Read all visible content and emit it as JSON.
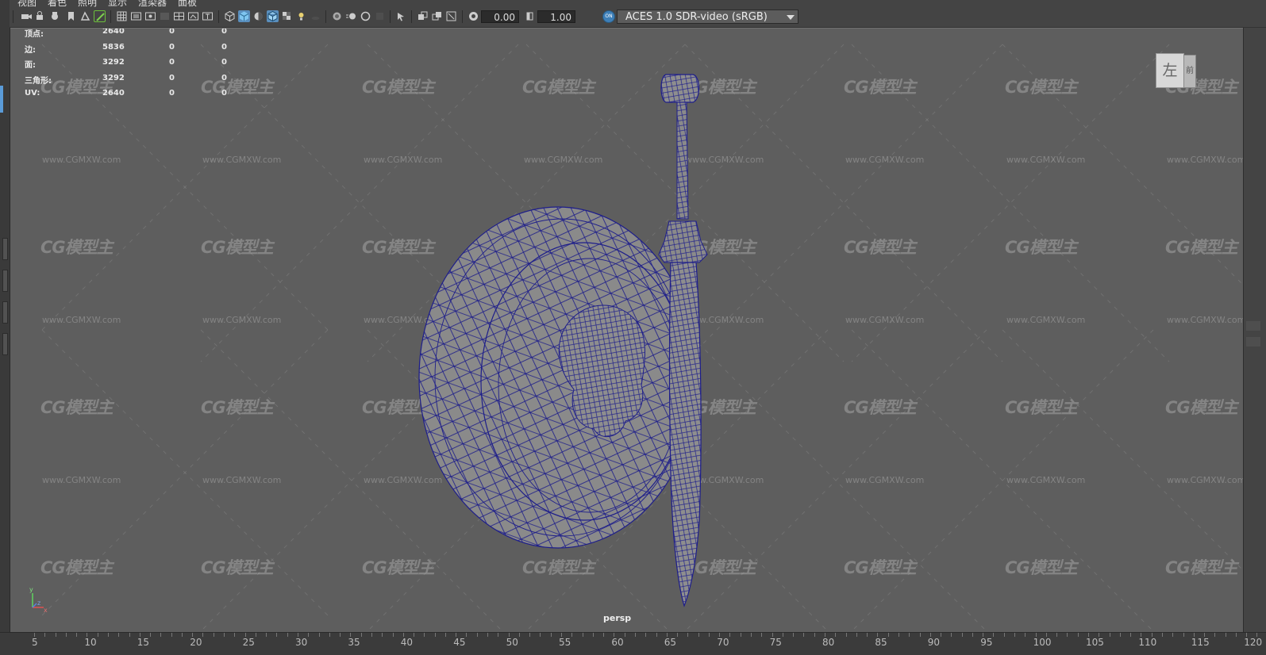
{
  "menu": [
    "视图",
    "着色",
    "照明",
    "显示",
    "渲染器",
    "面板"
  ],
  "toolbar": {
    "exposure_value": "0.00",
    "gamma_value": "1.00",
    "color_space": "ACES 1.0 SDR-video (sRGB)",
    "icons": [
      "camera-select-icon",
      "camera-attributes-icon",
      "bookmark-icon",
      "image-plane-icon",
      "film-gate-icon",
      "grid-icon",
      "wireframe-icon",
      "shaded-icon",
      "textured-icon",
      "lights-icon",
      "shadows-icon",
      "isolate-icon",
      "xray-icon",
      "exposure-icon",
      "gamma-icon",
      "color-management-icon"
    ]
  },
  "hud": {
    "rows": [
      {
        "label": "顶点:",
        "values": [
          "2640",
          "0",
          "0"
        ]
      },
      {
        "label": "边:",
        "values": [
          "5836",
          "0",
          "0"
        ]
      },
      {
        "label": "面:",
        "values": [
          "3292",
          "0",
          "0"
        ]
      },
      {
        "label": "三角形:",
        "values": [
          "3292",
          "0",
          "0"
        ]
      },
      {
        "label": "UV:",
        "values": [
          "2640",
          "0",
          "0"
        ]
      }
    ]
  },
  "watermark": {
    "logo_text": "CG模型主",
    "url_text": "www.CGMXW.com"
  },
  "viewcube": {
    "front_label": "左",
    "side_label": "前"
  },
  "camera_label": "persp",
  "axis": {
    "x": "x",
    "y": "y",
    "z": "z"
  },
  "timeline": {
    "ticks": [
      "5",
      "10",
      "15",
      "20",
      "25",
      "30",
      "35",
      "40",
      "45",
      "50",
      "55",
      "60",
      "65",
      "70",
      "75",
      "80",
      "85",
      "90",
      "95",
      "100",
      "105",
      "110",
      "115",
      "120"
    ]
  },
  "colors": {
    "wire": "#1a1a80",
    "viewport_bg": "#5e5e5e",
    "mesh_fill": "#8c8c8c",
    "accent": "#5a8fbe"
  }
}
